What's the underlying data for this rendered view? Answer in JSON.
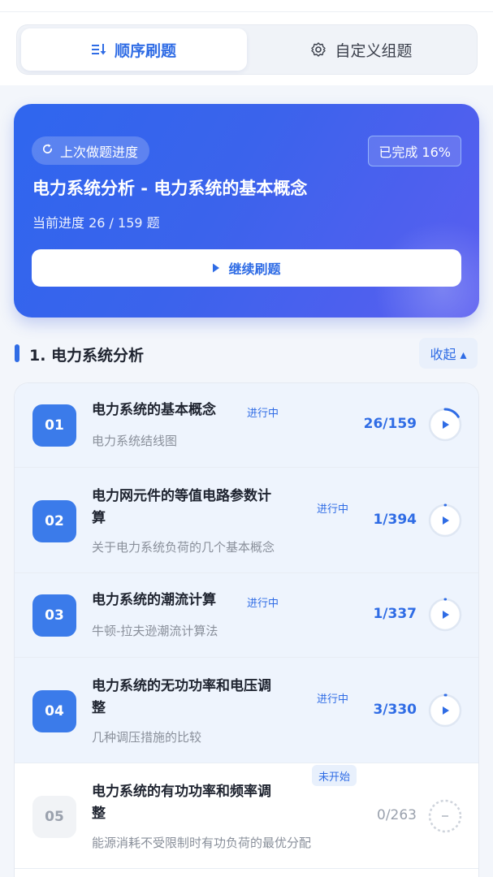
{
  "tabs": {
    "sequential_label": "顺序刷题",
    "custom_label": "自定义组题"
  },
  "hero": {
    "chip_label": "上次做题进度",
    "completed_badge": "已完成 16%",
    "title": "电力系统分析 - 电力系统的基本概念",
    "progress_text": "当前进度 26 / 159 题",
    "continue_label": "继续刷题"
  },
  "section": {
    "title": "1. 电力系统分析",
    "collapse_label": "收起 ▴"
  },
  "chapters": [
    {
      "num": "01",
      "title_lines": [
        "电力系统的基本概念"
      ],
      "subtitle": "电力系统结线图",
      "status": "进行中",
      "count": "26/159",
      "progress": 0.1635,
      "state": "active"
    },
    {
      "num": "02",
      "title_lines": [
        "电力网元件的等值电路参数计",
        "算"
      ],
      "subtitle": "关于电力系统负荷的几个基本概念",
      "status": "进行中",
      "count": "1/394",
      "progress": 0.0025,
      "state": "active"
    },
    {
      "num": "03",
      "title_lines": [
        "电力系统的潮流计算"
      ],
      "subtitle": "牛顿-拉夫逊潮流计算法",
      "status": "进行中",
      "count": "1/337",
      "progress": 0.003,
      "state": "active"
    },
    {
      "num": "04",
      "title_lines": [
        "电力系统的无功功率和电压调",
        "整"
      ],
      "subtitle": "几种调压措施的比较",
      "status": "进行中",
      "count": "3/330",
      "progress": 0.009,
      "state": "active"
    },
    {
      "num": "05",
      "title_lines": [
        "电力系统的有功功率和频率调",
        "整"
      ],
      "subtitle": "能源消耗不受限制时有功负荷的最优分配",
      "status": "未开始",
      "count": "0/263",
      "progress": 0,
      "state": "idle"
    }
  ],
  "colors": {
    "accent": "#2f6ce5",
    "hero_start": "#2f66ee",
    "hero_end": "#5a5ef0"
  }
}
